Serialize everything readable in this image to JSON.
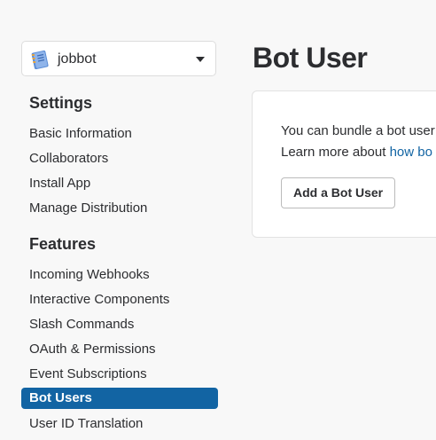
{
  "app_switcher": {
    "app_name": "jobbot",
    "icon": "app-notebook-icon"
  },
  "sidebar": {
    "settings_title": "Settings",
    "settings_items": [
      {
        "label": "Basic Information"
      },
      {
        "label": "Collaborators"
      },
      {
        "label": "Install App"
      },
      {
        "label": "Manage Distribution"
      }
    ],
    "features_title": "Features",
    "features_items": [
      {
        "label": "Incoming Webhooks"
      },
      {
        "label": "Interactive Components"
      },
      {
        "label": "Slash Commands"
      },
      {
        "label": "OAuth & Permissions"
      },
      {
        "label": "Event Subscriptions"
      },
      {
        "label": "Bot Users",
        "active": true
      },
      {
        "label": "User ID Translation"
      }
    ]
  },
  "main": {
    "title": "Bot User",
    "card": {
      "line1": "You can bundle a bot user",
      "line2_prefix": "Learn more about ",
      "line2_link": "how bo",
      "button_label": "Add a Bot User"
    }
  },
  "colors": {
    "accent": "#1264a3",
    "background": "#f8f8f8",
    "text": "#2c2d30"
  }
}
